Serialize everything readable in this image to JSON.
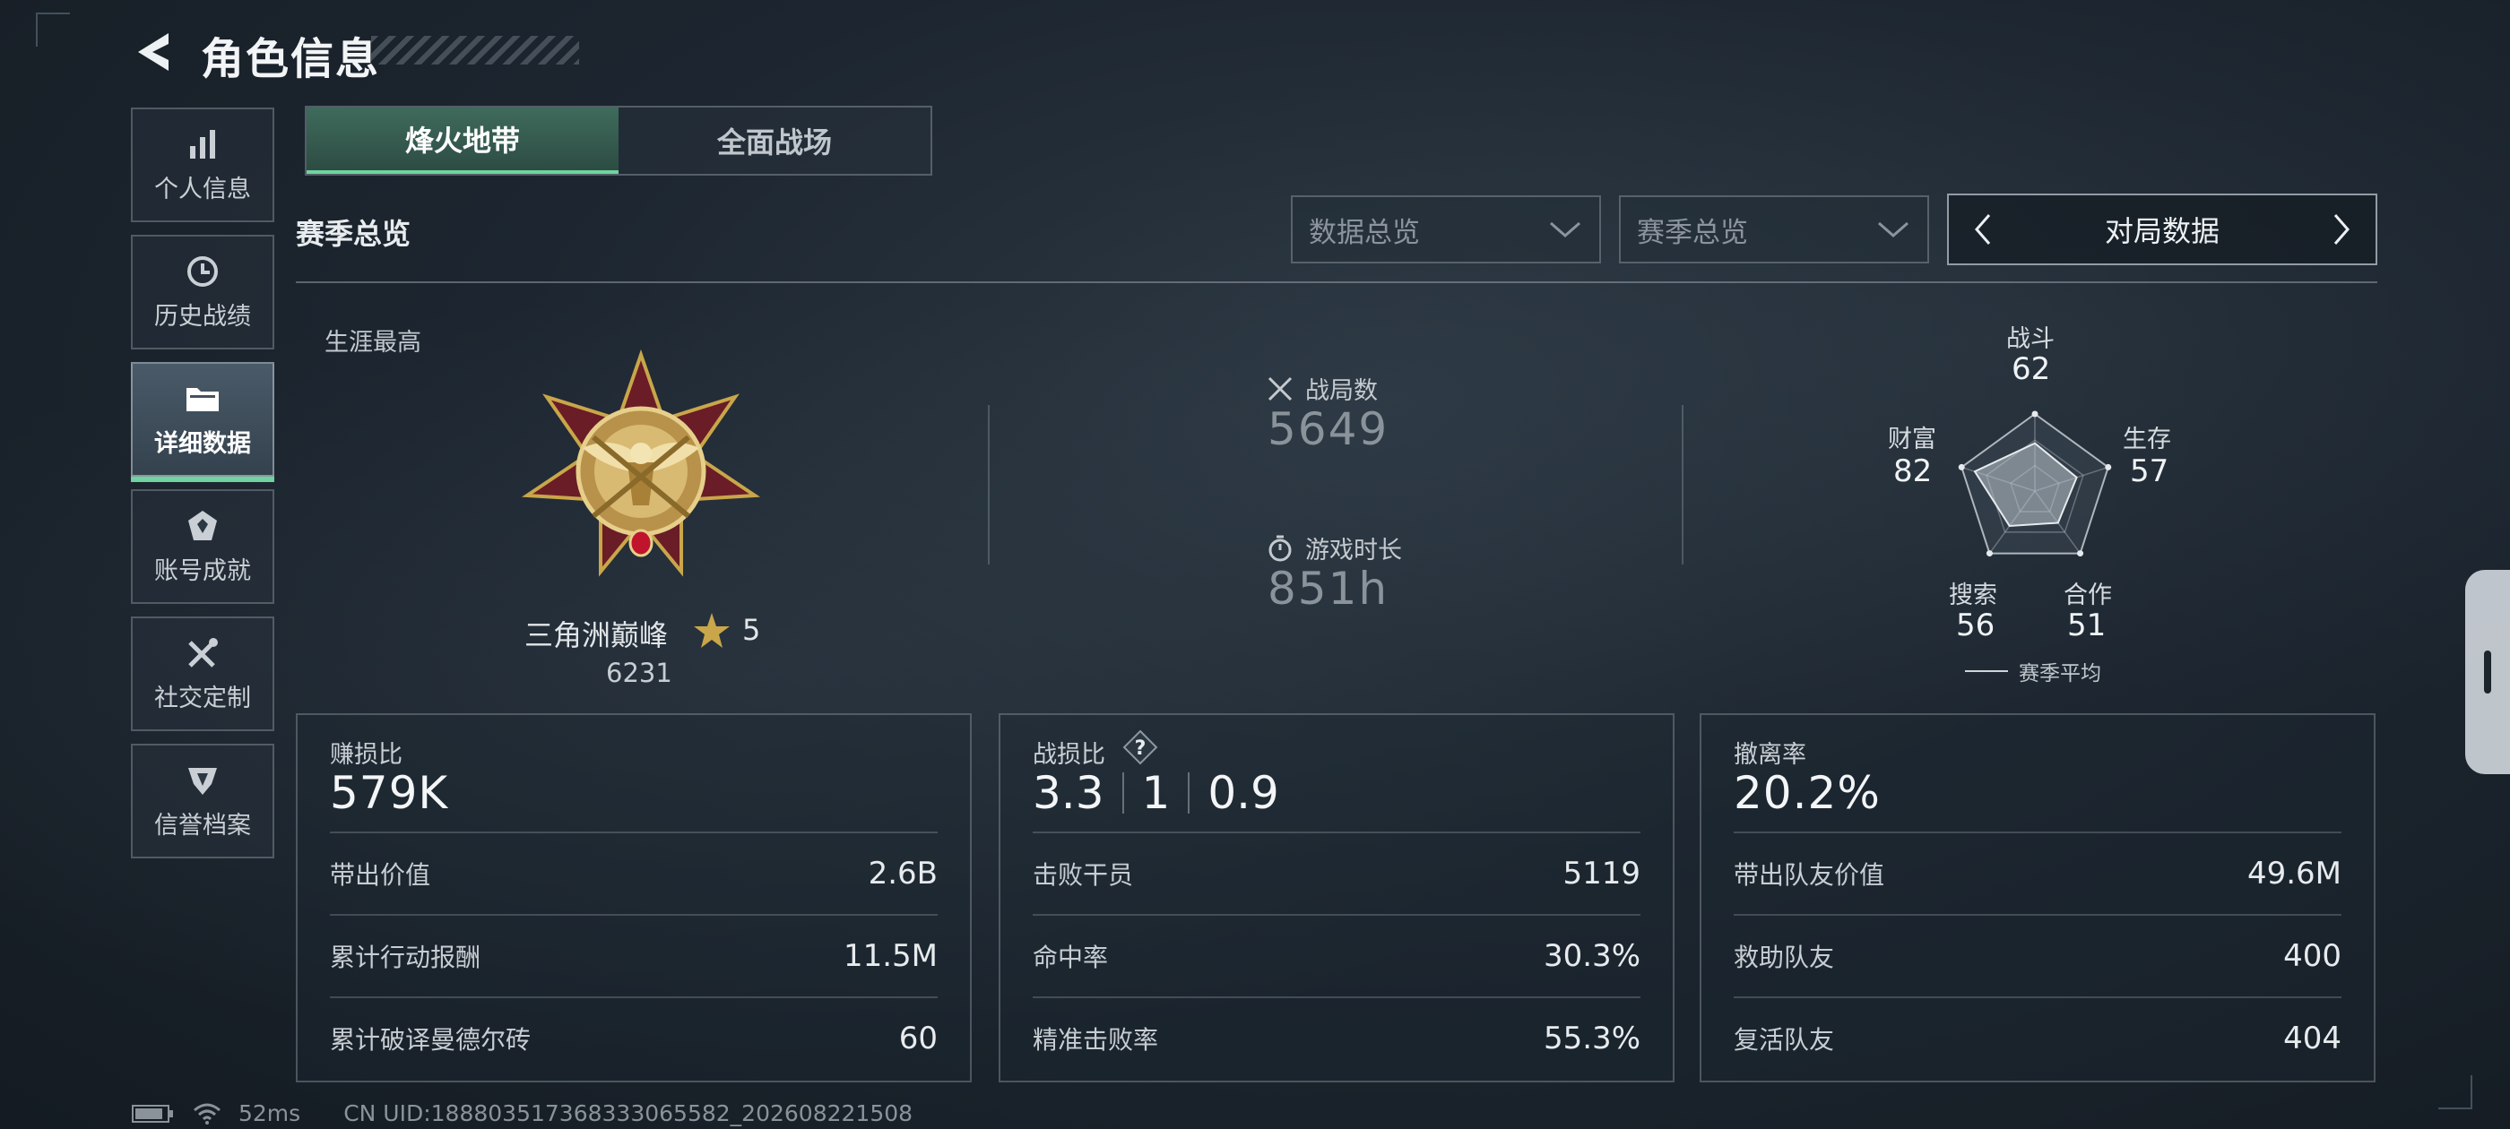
{
  "header": {
    "title": "角色信息",
    "back_icon": "back-arrow-icon"
  },
  "sidebar": {
    "items": [
      {
        "label": "个人信息",
        "icon": "bar-chart-icon"
      },
      {
        "label": "历史战绩",
        "icon": "history-clock-icon"
      },
      {
        "label": "详细数据",
        "icon": "folder-icon",
        "active": true
      },
      {
        "label": "账号成就",
        "icon": "achievement-icon"
      },
      {
        "label": "社交定制",
        "icon": "tools-icon"
      },
      {
        "label": "信誉档案",
        "icon": "shield-icon"
      }
    ]
  },
  "tabs": [
    {
      "label": "烽火地带",
      "active": true
    },
    {
      "label": "全面战场"
    }
  ],
  "section": {
    "title": "赛季总览"
  },
  "filters": {
    "dropdown1": "数据总览",
    "dropdown2": "赛季总览",
    "pager_label": "对局数据"
  },
  "career": {
    "label": "生涯最高",
    "rank_name": "三角洲巅峰",
    "rank_level": "5",
    "rank_score": "6231"
  },
  "stats": {
    "matches_label": "战局数",
    "matches_value": "5649",
    "playtime_label": "游戏时长",
    "playtime_value": "851h"
  },
  "radar": {
    "axes": [
      {
        "label": "战斗",
        "value": "62"
      },
      {
        "label": "生存",
        "value": "57"
      },
      {
        "label": "合作",
        "value": "51"
      },
      {
        "label": "搜索",
        "value": "56"
      },
      {
        "label": "财富",
        "value": "82"
      }
    ],
    "values": [
      62,
      57,
      51,
      56,
      82
    ],
    "legend": "赛季平均"
  },
  "cards": {
    "profit": {
      "label": "赚损比",
      "value": "579K",
      "rows": [
        {
          "k": "带出价值",
          "v": "2.6B"
        },
        {
          "k": "累计行动报酬",
          "v": "11.5M"
        },
        {
          "k": "累计破译曼德尔砖",
          "v": "60"
        }
      ]
    },
    "kd": {
      "label": "战损比",
      "values": [
        "3.3",
        "1",
        "0.9"
      ],
      "rows": [
        {
          "k": "击败干员",
          "v": "5119"
        },
        {
          "k": "命中率",
          "v": "30.3%"
        },
        {
          "k": "精准击败率",
          "v": "55.3%"
        }
      ]
    },
    "extract": {
      "label": "撤离率",
      "value": "20.2%",
      "rows": [
        {
          "k": "带出队友价值",
          "v": "49.6M"
        },
        {
          "k": "救助队友",
          "v": "400"
        },
        {
          "k": "复活队友",
          "v": "404"
        }
      ]
    }
  },
  "footer": {
    "ping": "52ms",
    "uid": "CN UID:18880351736833306558​2_202608221508"
  },
  "colors": {
    "accent": "#6fd3a0",
    "gold": "#c9a64a"
  }
}
